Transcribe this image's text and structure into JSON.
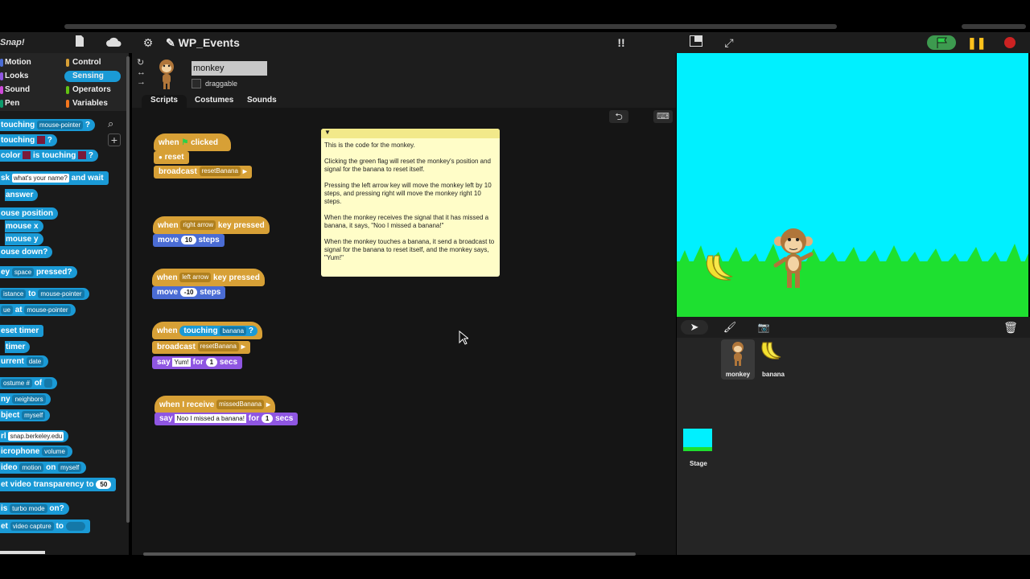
{
  "app": {
    "title": "WP_Events",
    "logo": "Snap!"
  },
  "topbar": {
    "file_icon": "file-icon",
    "cloud_icon": "cloud-icon",
    "settings_icon": "gear-icon",
    "stage_size_icon": "normal-stage-icon",
    "fullscreen_icon": "fullscreen-icon"
  },
  "categories": [
    {
      "label": "Motion",
      "color": "#4a6cd4"
    },
    {
      "label": "Control",
      "color": "#d7a036"
    },
    {
      "label": "Looks",
      "color": "#8f56e2"
    },
    {
      "label": "Sensing",
      "color": "#1a9ad6"
    },
    {
      "label": "Sound",
      "color": "#cf4ad9"
    },
    {
      "label": "Operators",
      "color": "#62c213"
    },
    {
      "label": "Pen",
      "color": "#0e9a6c"
    },
    {
      "label": "Variables",
      "color": "#f3761d"
    }
  ],
  "palette": {
    "touching": "touching",
    "mouse_pointer": "mouse-pointer",
    "touching_color_label": "touching",
    "color": "color",
    "is_touching": "is touching",
    "ask": "sk",
    "ask_default": "what's your name?",
    "and_wait": "and wait",
    "answer": "answer",
    "mouse_position": "ouse position",
    "mouse_x": "mouse x",
    "mouse_y": "mouse y",
    "mouse_down": "ouse down?",
    "key": "ey",
    "space": "space",
    "pressed": "pressed?",
    "distance": "istance",
    "to": "to",
    "ue": "ue",
    "at": "at",
    "reset_timer": "eset timer",
    "timer": "timer",
    "current": "urrent",
    "date": "date",
    "costume_num": "ostume #",
    "of": "of",
    "neighbors": "neighbors",
    "my": "ny",
    "object": "bject",
    "myself": "myself",
    "url": "rl",
    "url_value": "snap.berkeley.edu",
    "microphone": "icrophone",
    "volume": "volume",
    "video": "ideo",
    "motion": "motion",
    "on": "on",
    "set_video_transparency": "et video transparency to",
    "transparency_value": "50",
    "is": "is",
    "turbo_mode": "turbo mode",
    "on_q": "on?",
    "set": "et",
    "video_capture": "video capture"
  },
  "sprite": {
    "name": "monkey",
    "draggable": "draggable"
  },
  "tabs": [
    "Scripts",
    "Costumes",
    "Sounds"
  ],
  "scripts": {
    "s1": {
      "when": "when",
      "clicked": "clicked",
      "reset": "reset",
      "broadcast": "broadcast",
      "msg": "resetBanana"
    },
    "s2": {
      "when": "when",
      "key": "right arrow",
      "key_pressed": "key pressed",
      "move": "move",
      "steps_val": "10",
      "steps": "steps"
    },
    "s3": {
      "when": "when",
      "key": "left arrow",
      "key_pressed": "key pressed",
      "move": "move",
      "steps_val": "-10",
      "steps": "steps"
    },
    "s4": {
      "when": "when",
      "touching": "touching",
      "obj": "banana",
      "q": "?",
      "broadcast": "broadcast",
      "msg": "resetBanana",
      "say": "say",
      "text": "Yum!",
      "for": "for",
      "secs_val": "1",
      "secs": "secs"
    },
    "s5": {
      "when_receive": "when I receive",
      "msg": "missedBanana",
      "say": "say",
      "text": "Noo I missed a banana!",
      "for": "for",
      "secs_val": "1",
      "secs": "secs"
    }
  },
  "comment": "This is the code for the monkey.\n\nClicking the green flag will reset the monkey's position and signal for the banana to reset itself.\n\nPressing the left arrow key will move the monkey left by 10 steps, and pressing right will move the monkey right 10 steps.\n\nWhen the monkey receives the signal that it has missed a banana, it says, \"Noo I missed a banana!\"\n\nWhen the monkey touches a banana, it send a broadcast to signal for the banana to reset itself, and the monkey says, \"Yum!\"",
  "corral": {
    "sprites": [
      {
        "name": "monkey"
      },
      {
        "name": "banana"
      }
    ],
    "stage_label": "Stage"
  }
}
